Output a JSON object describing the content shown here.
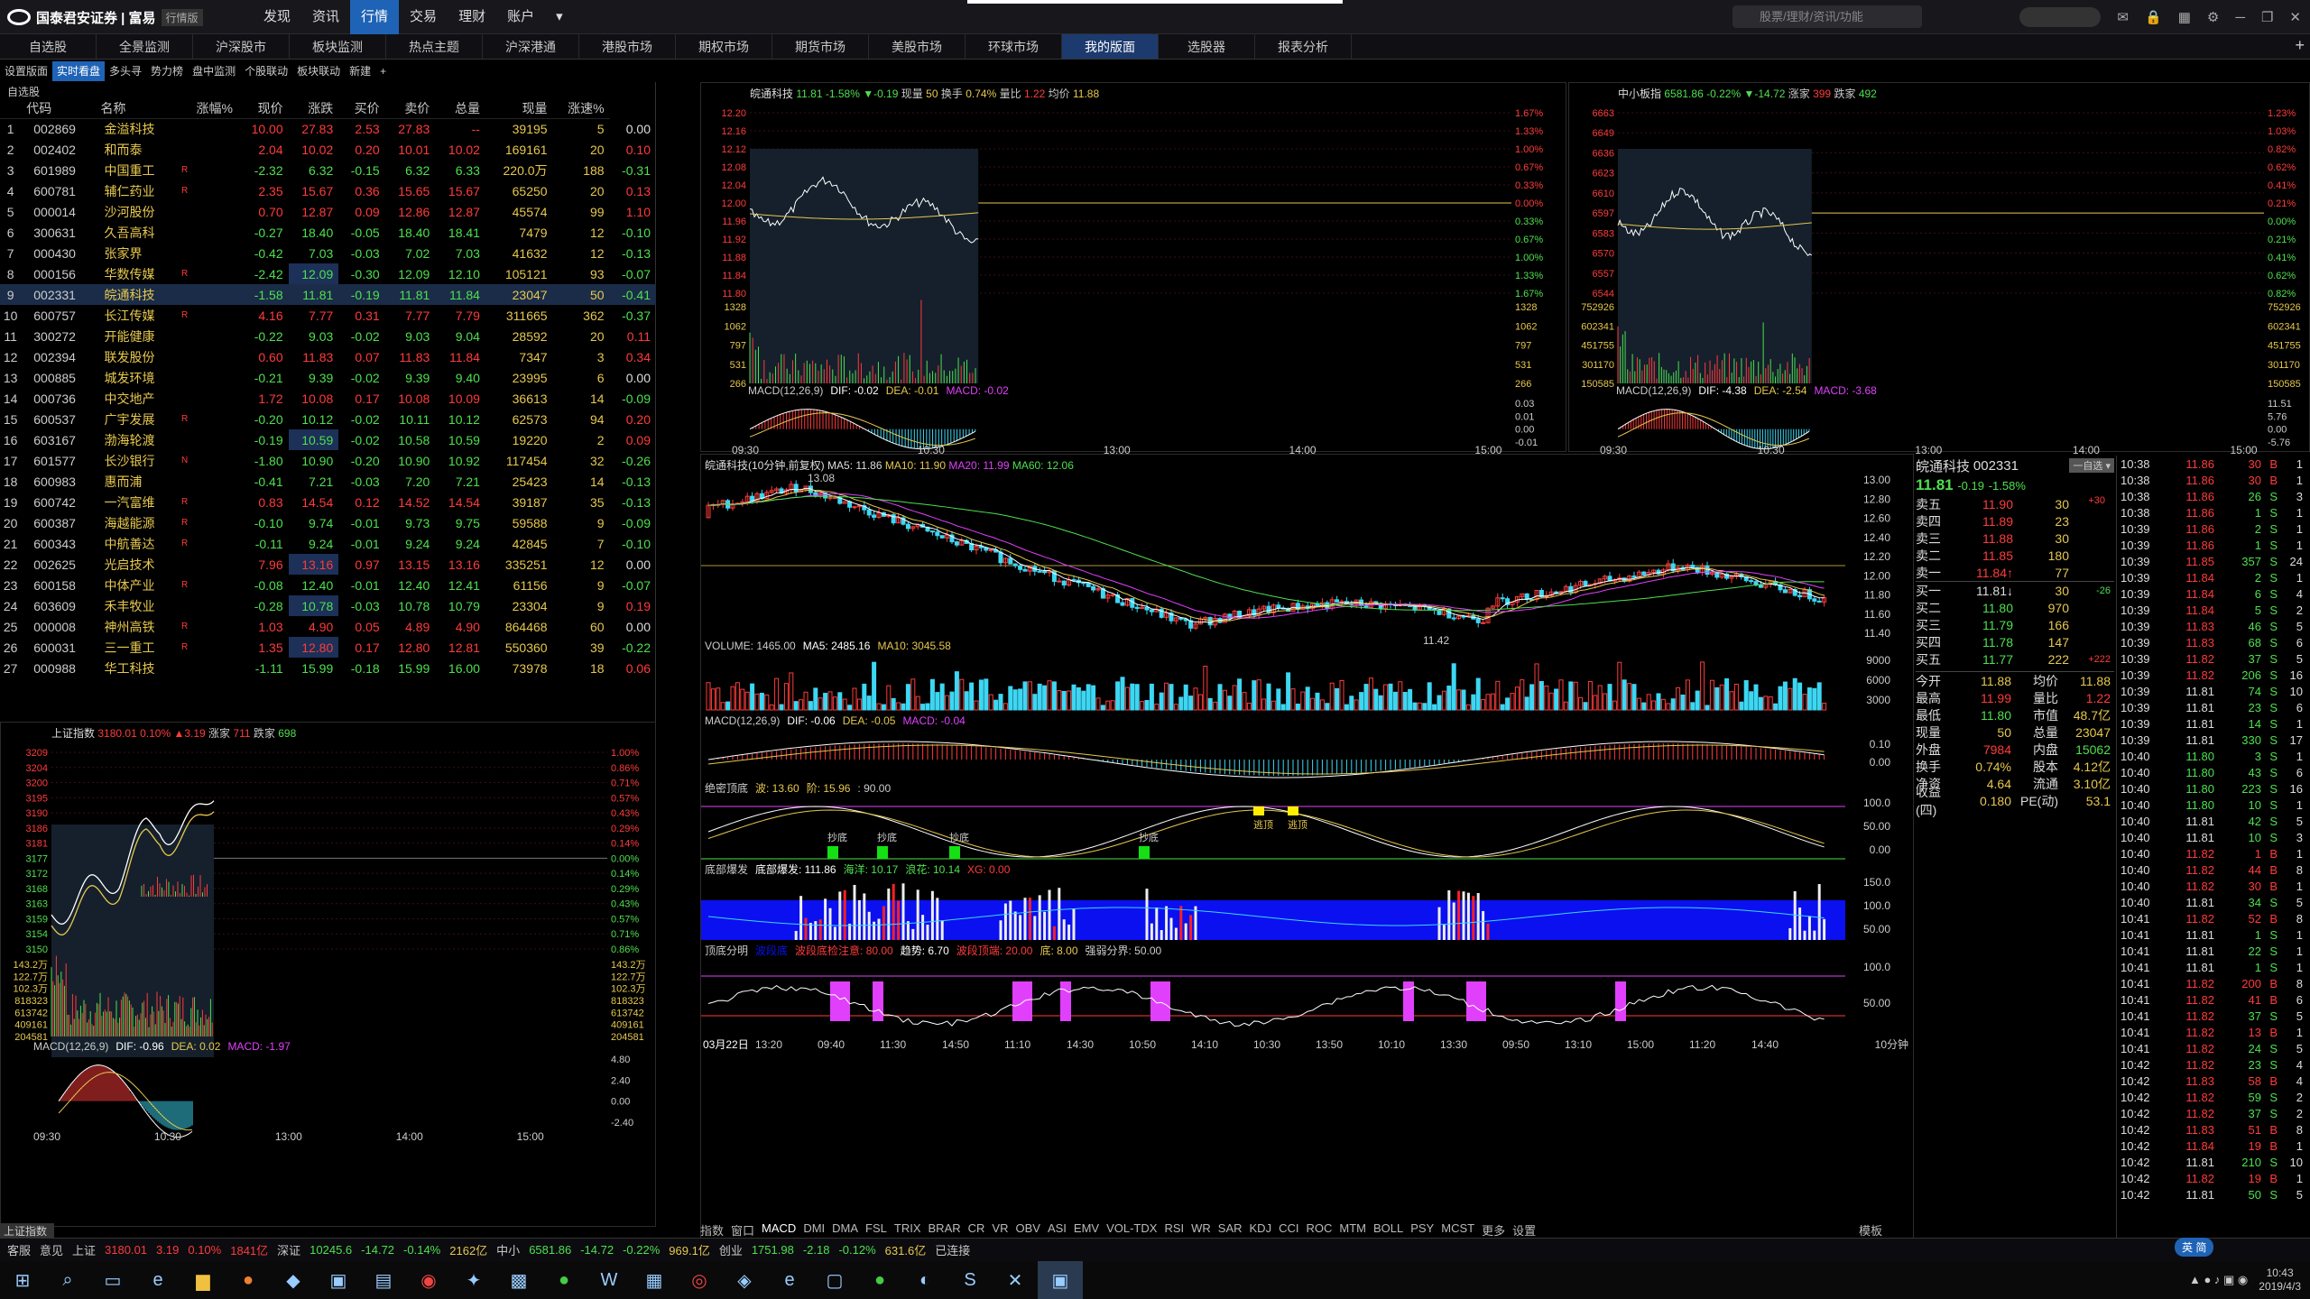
{
  "app": {
    "logo": "国泰君安证券 | 富易",
    "mode": "行情版"
  },
  "menu": [
    "发现",
    "资讯",
    "行情",
    "交易",
    "理财",
    "账户"
  ],
  "search_placeholder": "股票/理财/资讯/功能",
  "tabs": [
    "自选股",
    "全景监测",
    "沪深股市",
    "板块监测",
    "热点主题",
    "沪深港通",
    "港股市场",
    "期权市场",
    "期货市场",
    "美股市场",
    "环球市场",
    "我的版面",
    "选股器",
    "报表分析"
  ],
  "subtabs": [
    "设置版面",
    "实时看盘",
    "多头寻",
    "势力榜",
    "盘中监测",
    "个股联动",
    "板块联动",
    "新建"
  ],
  "list": {
    "title": "自选股",
    "headers": [
      "代码",
      "名称",
      "涨幅%",
      "现价",
      "涨跌",
      "买价",
      "卖价",
      "总量",
      "现量",
      "涨速%"
    ],
    "rows": [
      [
        "1",
        "002869",
        "金溢科技",
        "",
        "10.00",
        "27.83",
        "2.53",
        "27.83",
        "--",
        "39195",
        "5",
        "0.00"
      ],
      [
        "2",
        "002402",
        "和而泰",
        "",
        "2.04",
        "10.02",
        "0.20",
        "10.01",
        "10.02",
        "169161",
        "20",
        "0.10"
      ],
      [
        "3",
        "601989",
        "中国重工",
        "R",
        "-2.32",
        "6.32",
        "-0.15",
        "6.32",
        "6.33",
        "220.0万",
        "188",
        "-0.31"
      ],
      [
        "4",
        "600781",
        "辅仁药业",
        "R",
        "2.35",
        "15.67",
        "0.36",
        "15.65",
        "15.67",
        "65250",
        "20",
        "0.13"
      ],
      [
        "5",
        "000014",
        "沙河股份",
        "",
        "0.70",
        "12.87",
        "0.09",
        "12.86",
        "12.87",
        "45574",
        "99",
        "1.10"
      ],
      [
        "6",
        "300631",
        "久吾高科",
        "",
        "-0.27",
        "18.40",
        "-0.05",
        "18.40",
        "18.41",
        "7479",
        "12",
        "-0.10"
      ],
      [
        "7",
        "000430",
        "张家界",
        "",
        "-0.42",
        "7.03",
        "-0.03",
        "7.02",
        "7.03",
        "41632",
        "12",
        "-0.13"
      ],
      [
        "8",
        "000156",
        "华数传媒",
        "R",
        "-2.42",
        "12.09",
        "-0.30",
        "12.09",
        "12.10",
        "105121",
        "93",
        "-0.07"
      ],
      [
        "9",
        "002331",
        "皖通科技",
        "",
        "-1.58",
        "11.81",
        "-0.19",
        "11.81",
        "11.84",
        "23047",
        "50",
        "-0.41"
      ],
      [
        "10",
        "600757",
        "长江传媒",
        "R",
        "4.16",
        "7.77",
        "0.31",
        "7.77",
        "7.79",
        "311665",
        "362",
        "-0.37"
      ],
      [
        "11",
        "300272",
        "开能健康",
        "",
        "-0.22",
        "9.03",
        "-0.02",
        "9.03",
        "9.04",
        "28592",
        "20",
        "0.11"
      ],
      [
        "12",
        "002394",
        "联发股份",
        "",
        "0.60",
        "11.83",
        "0.07",
        "11.83",
        "11.84",
        "7347",
        "3",
        "0.34"
      ],
      [
        "13",
        "000885",
        "城发环境",
        "",
        "-0.21",
        "9.39",
        "-0.02",
        "9.39",
        "9.40",
        "23995",
        "6",
        "0.00"
      ],
      [
        "14",
        "000736",
        "中交地产",
        "",
        "1.72",
        "10.08",
        "0.17",
        "10.08",
        "10.09",
        "36613",
        "14",
        "-0.09"
      ],
      [
        "15",
        "600537",
        "广宇发展",
        "R",
        "-0.20",
        "10.12",
        "-0.02",
        "10.11",
        "10.12",
        "62573",
        "94",
        "0.20"
      ],
      [
        "16",
        "603167",
        "渤海轮渡",
        "",
        "-0.19",
        "10.59",
        "-0.02",
        "10.58",
        "10.59",
        "19220",
        "2",
        "0.09"
      ],
      [
        "17",
        "601577",
        "长沙银行",
        "N",
        "-1.80",
        "10.90",
        "-0.20",
        "10.90",
        "10.92",
        "117454",
        "32",
        "-0.26"
      ],
      [
        "18",
        "600983",
        "惠而浦",
        "",
        "-0.41",
        "7.21",
        "-0.03",
        "7.20",
        "7.21",
        "25423",
        "14",
        "-0.13"
      ],
      [
        "19",
        "600742",
        "一汽富维",
        "R",
        "0.83",
        "14.54",
        "0.12",
        "14.52",
        "14.54",
        "39187",
        "35",
        "-0.13"
      ],
      [
        "20",
        "600387",
        "海越能源",
        "R",
        "-0.10",
        "9.74",
        "-0.01",
        "9.73",
        "9.75",
        "59588",
        "9",
        "-0.09"
      ],
      [
        "21",
        "600343",
        "中航善达",
        "R",
        "-0.11",
        "9.24",
        "-0.01",
        "9.24",
        "9.24",
        "42845",
        "7",
        "-0.10"
      ],
      [
        "22",
        "002625",
        "光启技术",
        "",
        "7.96",
        "13.16",
        "0.97",
        "13.15",
        "13.16",
        "335251",
        "12",
        "0.00"
      ],
      [
        "23",
        "600158",
        "中体产业",
        "R",
        "-0.08",
        "12.40",
        "-0.01",
        "12.40",
        "12.41",
        "61156",
        "9",
        "-0.07"
      ],
      [
        "24",
        "603609",
        "禾丰牧业",
        "",
        "-0.28",
        "10.78",
        "-0.03",
        "10.78",
        "10.79",
        "23304",
        "9",
        "0.19"
      ],
      [
        "25",
        "000008",
        "神州高铁",
        "R",
        "1.03",
        "4.90",
        "0.05",
        "4.89",
        "4.90",
        "864468",
        "60",
        "0.00"
      ],
      [
        "26",
        "600031",
        "三一重工",
        "R",
        "1.35",
        "12.80",
        "0.17",
        "12.80",
        "12.81",
        "550360",
        "39",
        "-0.22"
      ],
      [
        "27",
        "000988",
        "华工科技",
        "",
        "-1.11",
        "15.99",
        "-0.18",
        "15.99",
        "16.00",
        "73978",
        "18",
        "0.06"
      ]
    ]
  },
  "index_panel": {
    "title": "上证指数",
    "value": "3180.01",
    "pct": "0.10%",
    "chg": "▲3.19",
    "up_label": "涨家",
    "up_count": "711",
    "dn_label": "跌家",
    "dn_count": "698",
    "left_axis": [
      "3209",
      "3204",
      "3200",
      "3195",
      "3190",
      "3186",
      "3181",
      "3177",
      "3172",
      "3168",
      "3163",
      "3159",
      "3154",
      "3150"
    ],
    "right_axis": [
      "1.00%",
      "0.86%",
      "0.71%",
      "0.57%",
      "0.43%",
      "0.29%",
      "0.14%",
      "0.00%",
      "0.14%",
      "0.29%",
      "0.43%",
      "0.57%",
      "0.71%",
      "0.86%"
    ],
    "vol_axis": [
      "143.2万",
      "122.7万",
      "102.3万",
      "818323",
      "613742",
      "409161",
      "204581"
    ],
    "macd": "MACD(12,26,9)",
    "dif": "DIF: -0.96",
    "dea": "DEA: 0.02",
    "macdv": "MACD: -1.97",
    "macd_axis": [
      "4.80",
      "2.40",
      "0.00",
      "-2.40"
    ],
    "times": [
      "09:30",
      "10:30",
      "13:00",
      "14:00",
      "15:00"
    ],
    "bottom_label": "上证指数"
  },
  "intraday1": {
    "title": "皖通科技",
    "price": "11.81",
    "pct": "-1.58%",
    "chg": "▼-0.19",
    "vol_label": "现量",
    "vol": "50",
    "turn_label": "换手",
    "turn": "0.74%",
    "vr_label": "量比",
    "vr": "1.22",
    "avg_label": "均价",
    "avg": "11.88",
    "left_axis": [
      "12.20",
      "12.16",
      "12.12",
      "12.08",
      "12.04",
      "12.00",
      "11.96",
      "11.92",
      "11.88",
      "11.84",
      "11.80"
    ],
    "right_axis": [
      "1.67%",
      "1.33%",
      "1.00%",
      "0.67%",
      "0.33%",
      "0.00%",
      "0.33%",
      "0.67%",
      "1.00%",
      "1.33%",
      "1.67%"
    ],
    "vol_axis": [
      "1328",
      "1062",
      "797",
      "531",
      "266"
    ],
    "macd": "MACD(12,26,9)",
    "dif": "DIF: -0.02",
    "dea": "DEA: -0.01",
    "macdv": "MACD: -0.02",
    "macd_axis": [
      "0.03",
      "0.01",
      "0.00",
      "-0.01"
    ],
    "times": [
      "09:30",
      "10:30",
      "13:00",
      "14:00",
      "15:00"
    ]
  },
  "intraday2": {
    "title": "中小板指",
    "value": "6581.86",
    "pct": "-0.22%",
    "chg": "▼-14.72",
    "up_label": "涨家",
    "up_count": "399",
    "dn_label": "跌家",
    "dn_count": "492",
    "left_axis": [
      "6663",
      "6649",
      "6636",
      "6623",
      "6610",
      "6597",
      "6583",
      "6570",
      "6557",
      "6544"
    ],
    "right_axis": [
      "1.23%",
      "1.03%",
      "0.82%",
      "0.62%",
      "0.41%",
      "0.21%",
      "0.00%",
      "0.21%",
      "0.41%",
      "0.62%",
      "0.82%"
    ],
    "vol_axis": [
      "752926",
      "602341",
      "451755",
      "301170",
      "150585"
    ],
    "macd": "MACD(12,26,9)",
    "dif": "DIF: -4.38",
    "dea": "DEA: -2.54",
    "macdv": "MACD: -3.68",
    "macd_axis": [
      "11.51",
      "5.76",
      "0.00",
      "-5.76"
    ],
    "times": [
      "09:30",
      "10:30",
      "13:00",
      "14:00",
      "15:00"
    ]
  },
  "kline": {
    "title": "皖通科技(10分钟,前复权)",
    "ma5": "MA5: 11.86",
    "ma10": "MA10: 11.90",
    "ma20": "MA20: 11.99",
    "ma60": "MA60: 12.06",
    "high_mark": "13.08",
    "low_mark": "11.42",
    "price_axis": [
      "13.00",
      "12.80",
      "12.60",
      "12.40",
      "12.20",
      "12.00",
      "11.80",
      "11.60",
      "11.40"
    ],
    "volume": "VOLUME: 1465.00",
    "vma5": "MA5: 2485.16",
    "vma10": "MA10: 3045.58",
    "vol_axis": [
      "9000",
      "6000",
      "3000"
    ],
    "macd": "MACD(12,26,9)",
    "dif": "DIF: -0.06",
    "dea": "DEA: -0.05",
    "macdv": "MACD: -0.04",
    "macd_axis": [
      "0.10",
      "0.00"
    ],
    "top_ind": "绝密顶底",
    "top_wave": "波: 13.60",
    "top_phase": "阶: 15.96",
    "top_extra": ": 90.00",
    "top_axis": [
      "100.0",
      "50.00",
      "0.00"
    ],
    "buy_label": "抄底",
    "sell_label": "逃顶",
    "bottom_ind": "底部爆发",
    "bottom_val": "底部爆发: 111.86",
    "sea": "海洋: 10.17",
    "wave": "浪花: 10.14",
    "xg": "XG: 0.00",
    "bottom_axis": [
      "150.0",
      "100.0",
      "50.00"
    ],
    "trend_ind": "顶底分明",
    "trend1": "波段底",
    "trend2": "波段底检注意: 80.00",
    "trend3": "趋势: 6.70",
    "trend4": "波段顶端: 20.00",
    "trend5": "底: 8.00",
    "trend6": "强弱分界: 50.00",
    "trend_axis": [
      "100.0",
      "50.00"
    ],
    "date": "03月22日",
    "times": [
      "13:20",
      "09:40",
      "11:30",
      "14:50",
      "11:10",
      "14:30",
      "10:50",
      "14:10",
      "10:30",
      "13:50",
      "10:10",
      "13:30",
      "09:50",
      "13:10",
      "15:00",
      "11:20",
      "14:40"
    ],
    "period": "10分钟",
    "indicators": [
      "指数",
      "窗口",
      "MACD",
      "DMI",
      "DMA",
      "FSL",
      "TRIX",
      "BRAR",
      "CR",
      "VR",
      "OBV",
      "ASI",
      "EMV",
      "VOL-TDX",
      "RSI",
      "WR",
      "SAR",
      "KDJ",
      "CCI",
      "ROC",
      "MTM",
      "BOLL",
      "PSY",
      "MCST",
      "更多",
      "设置"
    ],
    "template": "模板"
  },
  "quote": {
    "name": "皖通科技",
    "code": "002331",
    "price": "11.81",
    "chg": "-0.19",
    "pct": "-1.58%",
    "asks": [
      [
        "卖五",
        "11.90",
        "30",
        ""
      ],
      [
        "卖四",
        "11.89",
        "23",
        ""
      ],
      [
        "卖三",
        "11.88",
        "30",
        ""
      ],
      [
        "卖二",
        "11.85",
        "180",
        ""
      ],
      [
        "卖一",
        "11.84↑",
        "77",
        ""
      ]
    ],
    "bids": [
      [
        "买一",
        "11.81↓",
        "30",
        "-26"
      ],
      [
        "买二",
        "11.80",
        "970",
        ""
      ],
      [
        "买三",
        "11.79",
        "166",
        ""
      ],
      [
        "买四",
        "11.78",
        "147",
        ""
      ],
      [
        "买五",
        "11.77",
        "222",
        "+222"
      ]
    ],
    "ask_flag": "+30",
    "stats": [
      [
        "今开",
        "11.88",
        "均价",
        "11.88"
      ],
      [
        "最高",
        "11.99",
        "量比",
        "1.22"
      ],
      [
        "最低",
        "11.80",
        "市值",
        "48.7亿"
      ],
      [
        "现量",
        "50",
        "总量",
        "23047"
      ],
      [
        "外盘",
        "7984",
        "内盘",
        "15062"
      ],
      [
        "换手",
        "0.74%",
        "股本",
        "4.12亿"
      ],
      [
        "净资",
        "4.64",
        "流通",
        "3.10亿"
      ],
      [
        "收益(四)",
        "0.180",
        "PE(动)",
        "53.1"
      ]
    ]
  },
  "ticks": [
    [
      "10:38",
      "11.86",
      "30",
      "B",
      "1"
    ],
    [
      "10:38",
      "11.86",
      "30",
      "B",
      "1"
    ],
    [
      "10:38",
      "11.86",
      "26",
      "S",
      "3"
    ],
    [
      "10:38",
      "11.86",
      "1",
      "S",
      "1"
    ],
    [
      "10:39",
      "11.86",
      "2",
      "S",
      "1"
    ],
    [
      "10:39",
      "11.86",
      "1",
      "S",
      "1"
    ],
    [
      "10:39",
      "11.85",
      "357",
      "S",
      "24"
    ],
    [
      "10:39",
      "11.84",
      "2",
      "S",
      "1"
    ],
    [
      "10:39",
      "11.84",
      "6",
      "S",
      "4"
    ],
    [
      "10:39",
      "11.84",
      "5",
      "S",
      "2"
    ],
    [
      "10:39",
      "11.83",
      "46",
      "S",
      "5"
    ],
    [
      "10:39",
      "11.83",
      "68",
      "S",
      "6"
    ],
    [
      "10:39",
      "11.82",
      "37",
      "S",
      "5"
    ],
    [
      "10:39",
      "11.82",
      "206",
      "S",
      "16"
    ],
    [
      "10:39",
      "11.81",
      "74",
      "S",
      "10"
    ],
    [
      "10:39",
      "11.81",
      "23",
      "S",
      "6"
    ],
    [
      "10:39",
      "11.81",
      "14",
      "S",
      "1"
    ],
    [
      "10:39",
      "11.81",
      "330",
      "S",
      "17"
    ],
    [
      "10:40",
      "11.80",
      "3",
      "S",
      "1"
    ],
    [
      "10:40",
      "11.80",
      "43",
      "S",
      "6"
    ],
    [
      "10:40",
      "11.80",
      "223",
      "S",
      "16"
    ],
    [
      "10:40",
      "11.80",
      "10",
      "S",
      "1"
    ],
    [
      "10:40",
      "11.81",
      "42",
      "S",
      "5"
    ],
    [
      "10:40",
      "11.81",
      "10",
      "S",
      "3"
    ],
    [
      "10:40",
      "11.82",
      "1",
      "B",
      "1"
    ],
    [
      "10:40",
      "11.82",
      "44",
      "B",
      "8"
    ],
    [
      "10:40",
      "11.82",
      "30",
      "B",
      "1"
    ],
    [
      "10:40",
      "11.81",
      "34",
      "S",
      "5"
    ],
    [
      "10:41",
      "11.82",
      "52",
      "B",
      "8"
    ],
    [
      "10:41",
      "11.81",
      "1",
      "S",
      "1"
    ],
    [
      "10:41",
      "11.81",
      "22",
      "S",
      "1"
    ],
    [
      "10:41",
      "11.81",
      "1",
      "S",
      "1"
    ],
    [
      "10:41",
      "11.82",
      "200",
      "B",
      "8"
    ],
    [
      "10:41",
      "11.82",
      "41",
      "B",
      "6"
    ],
    [
      "10:41",
      "11.82",
      "37",
      "S",
      "5"
    ],
    [
      "10:41",
      "11.82",
      "13",
      "B",
      "1"
    ],
    [
      "10:41",
      "11.82",
      "24",
      "S",
      "5"
    ],
    [
      "10:42",
      "11.82",
      "23",
      "S",
      "4"
    ],
    [
      "10:42",
      "11.83",
      "58",
      "B",
      "4"
    ],
    [
      "10:42",
      "11.82",
      "59",
      "S",
      "2"
    ],
    [
      "10:42",
      "11.82",
      "37",
      "S",
      "2"
    ],
    [
      "10:42",
      "11.83",
      "51",
      "B",
      "8"
    ],
    [
      "10:42",
      "11.84",
      "19",
      "B",
      "1"
    ],
    [
      "10:42",
      "11.81",
      "210",
      "S",
      "10"
    ],
    [
      "10:42",
      "11.82",
      "19",
      "B",
      "1"
    ],
    [
      "10:42",
      "11.81",
      "50",
      "S",
      "5"
    ]
  ],
  "statusbar": {
    "items": [
      "客服",
      "意见",
      "上证",
      "3180.01",
      "3.19",
      "0.10%",
      "1841亿",
      "深证",
      "10245.6",
      "-14.72",
      "-0.14%",
      "2162亿",
      "中小",
      "6581.86",
      "-14.72",
      "-0.22%",
      "969.1亿",
      "创业",
      "1751.98",
      "-2.18",
      "-0.12%",
      "631.6亿",
      "已连接"
    ]
  },
  "clock": {
    "time": "10:43",
    "date": "2019/4/3"
  },
  "ime": "英 简"
}
